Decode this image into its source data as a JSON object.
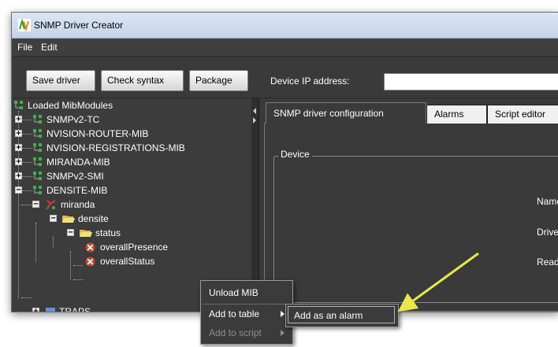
{
  "window": {
    "title": "SNMP Driver Creator"
  },
  "menu": {
    "file": "File",
    "edit": "Edit"
  },
  "toolbar": {
    "save_driver": "Save driver",
    "check_syntax": "Check syntax",
    "package": "Package",
    "device_ip_label": "Device IP address:",
    "device_ip_value": ""
  },
  "tree": {
    "root": "Loaded MibModules",
    "modules": [
      "SNMPv2-TC",
      "NVISION-ROUTER-MIB",
      "NVISION-REGISTRATIONS-MIB",
      "MIRANDA-MIB",
      "SNMPv2-SMI",
      "DENSITE-MIB"
    ],
    "miranda": "miranda",
    "densite": "densite",
    "status": "status",
    "overall_presence": "overallPresence",
    "overall_status": "overallStatus",
    "traps": "TRAPS"
  },
  "tabs": [
    "SNMP driver configuration",
    "Alarms",
    "Script editor"
  ],
  "device": {
    "legend": "Device",
    "labels": [
      "Name",
      "Driver",
      "Read"
    ]
  },
  "context_menu": {
    "unload_mib": "Unload MIB",
    "add_to_table": "Add to table",
    "add_to_script": "Add to script",
    "submenu_item": "Add as an alarm"
  },
  "colors": {
    "panel_bg": "#3a3a3a",
    "highlight_arrow": "#e8e84a",
    "titlebar": "#dbe6f4"
  }
}
